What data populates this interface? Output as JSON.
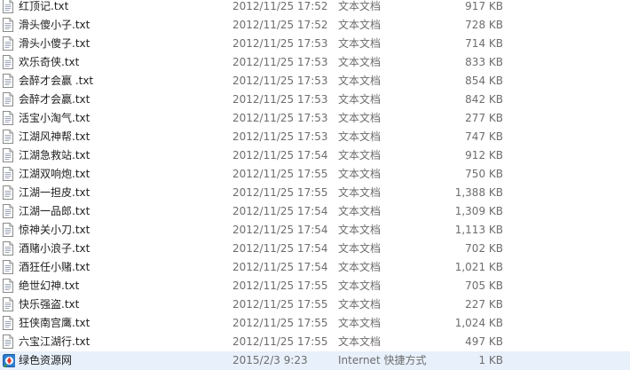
{
  "files": [
    {
      "name": "红顶记.txt",
      "modified": "2012/11/25 17:52",
      "type": "文本文档",
      "size": "917 KB",
      "icon": "text-file-icon"
    },
    {
      "name": "滑头傻小子.txt",
      "modified": "2012/11/25 17:52",
      "type": "文本文档",
      "size": "728 KB",
      "icon": "text-file-icon"
    },
    {
      "name": "滑头小傻子.txt",
      "modified": "2012/11/25 17:53",
      "type": "文本文档",
      "size": "714 KB",
      "icon": "text-file-icon"
    },
    {
      "name": "欢乐奇侠.txt",
      "modified": "2012/11/25 17:53",
      "type": "文本文档",
      "size": "833 KB",
      "icon": "text-file-icon"
    },
    {
      "name": "会醉才会赢 .txt",
      "modified": "2012/11/25 17:53",
      "type": "文本文档",
      "size": "854 KB",
      "icon": "text-file-icon"
    },
    {
      "name": "会醉才会赢.txt",
      "modified": "2012/11/25 17:53",
      "type": "文本文档",
      "size": "842 KB",
      "icon": "text-file-icon"
    },
    {
      "name": "活宝小淘气.txt",
      "modified": "2012/11/25 17:53",
      "type": "文本文档",
      "size": "277 KB",
      "icon": "text-file-icon"
    },
    {
      "name": "江湖风神帮.txt",
      "modified": "2012/11/25 17:53",
      "type": "文本文档",
      "size": "747 KB",
      "icon": "text-file-icon"
    },
    {
      "name": "江湖急救站.txt",
      "modified": "2012/11/25 17:54",
      "type": "文本文档",
      "size": "912 KB",
      "icon": "text-file-icon"
    },
    {
      "name": "江湖双响炮.txt",
      "modified": "2012/11/25 17:55",
      "type": "文本文档",
      "size": "750 KB",
      "icon": "text-file-icon"
    },
    {
      "name": "江湖一担皮.txt",
      "modified": "2012/11/25 17:55",
      "type": "文本文档",
      "size": "1,388 KB",
      "icon": "text-file-icon"
    },
    {
      "name": "江湖一品郎.txt",
      "modified": "2012/11/25 17:54",
      "type": "文本文档",
      "size": "1,309 KB",
      "icon": "text-file-icon"
    },
    {
      "name": "惊神关小刀.txt",
      "modified": "2012/11/25 17:54",
      "type": "文本文档",
      "size": "1,113 KB",
      "icon": "text-file-icon"
    },
    {
      "name": "酒赌小浪子.txt",
      "modified": "2012/11/25 17:54",
      "type": "文本文档",
      "size": "702 KB",
      "icon": "text-file-icon"
    },
    {
      "name": "酒狂任小赌.txt",
      "modified": "2012/11/25 17:54",
      "type": "文本文档",
      "size": "1,021 KB",
      "icon": "text-file-icon"
    },
    {
      "name": "绝世幻神.txt",
      "modified": "2012/11/25 17:55",
      "type": "文本文档",
      "size": "705 KB",
      "icon": "text-file-icon"
    },
    {
      "name": "快乐强盗.txt",
      "modified": "2012/11/25 17:55",
      "type": "文本文档",
      "size": "227 KB",
      "icon": "text-file-icon"
    },
    {
      "name": "狂侠南宫鹰.txt",
      "modified": "2012/11/25 17:55",
      "type": "文本文档",
      "size": "1,024 KB",
      "icon": "text-file-icon"
    },
    {
      "name": "六宝江湖行.txt",
      "modified": "2012/11/25 17:55",
      "type": "文本文档",
      "size": "497 KB",
      "icon": "text-file-icon"
    },
    {
      "name": "绿色资源网",
      "modified": "2015/2/3 9:23",
      "type": "Internet 快捷方式",
      "size": "1 KB",
      "icon": "internet-shortcut-icon",
      "highlighted": true
    }
  ],
  "colors": {
    "row_highlight": "#e8f0fb",
    "secondary_text": "#6d6d6d",
    "primary_text": "#1e1e1e"
  }
}
